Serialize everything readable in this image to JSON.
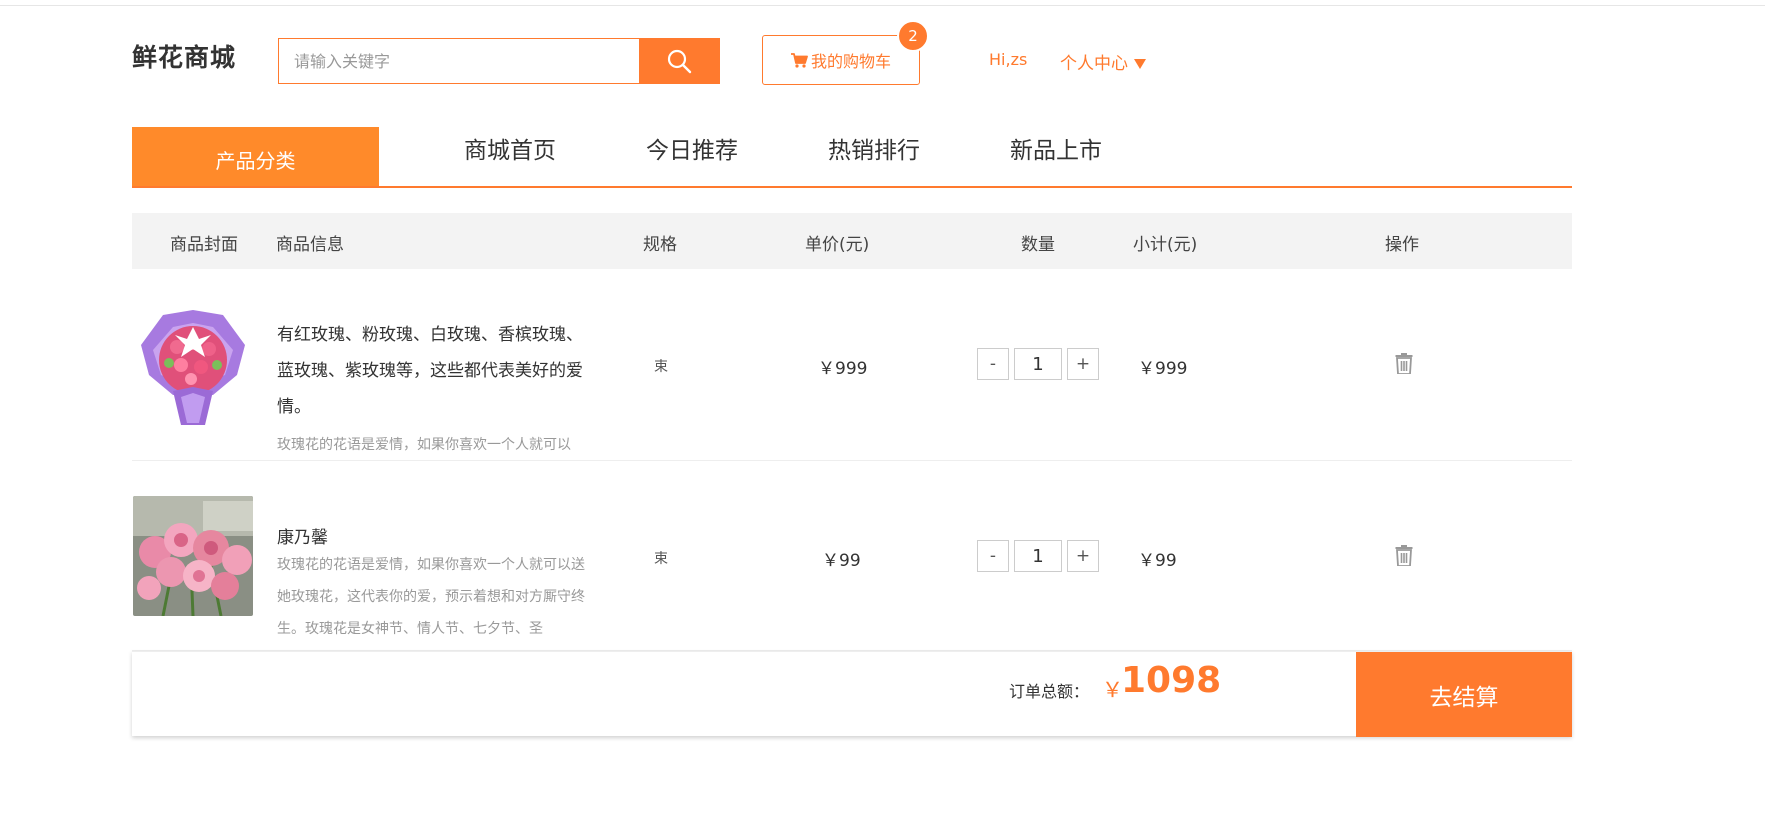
{
  "brand": {
    "logo": "鲜花商城",
    "accent": "#ff7a2e"
  },
  "search": {
    "placeholder": "请输入关键字",
    "value": "",
    "icon": "search-icon"
  },
  "header": {
    "cart_label": "我的购物车",
    "cart_icon": "shopping-cart-icon",
    "cart_count": "2",
    "greeting": "Hi,zs",
    "user_center": "个人中心"
  },
  "nav": {
    "category": "产品分类",
    "links": [
      "商城首页",
      "今日推荐",
      "热销排行",
      "新品上市"
    ]
  },
  "table": {
    "headers": [
      "商品封面",
      "商品信息",
      "规格",
      "单价(元)",
      "数量",
      "小计(元)",
      "操作"
    ],
    "rows": [
      {
        "title": "有红玫瑰、粉玫瑰、白玫瑰、香槟玫瑰、蓝玫瑰、紫玫瑰等，这些都代表美好的爱情。",
        "subtitle": "玫瑰花的花语是爱情，如果你喜欢一个人就可以",
        "spec": "束",
        "price": "￥999",
        "quantity": "1",
        "subtotal": "￥999",
        "dec": "-",
        "inc": "+"
      },
      {
        "title": "康乃馨",
        "subtitle": "玫瑰花的花语是爱情，如果你喜欢一个人就可以送她玫瑰花，这代表你的爱，预示着想和对方厮守终生。玫瑰花是女神节、情人节、七夕节、圣",
        "spec": "束",
        "price": "￥99",
        "quantity": "1",
        "subtotal": "￥99",
        "dec": "-",
        "inc": "+"
      }
    ]
  },
  "summary": {
    "total_label": "订单总额：",
    "currency": "￥",
    "total": "1098",
    "checkout": "去结算"
  }
}
